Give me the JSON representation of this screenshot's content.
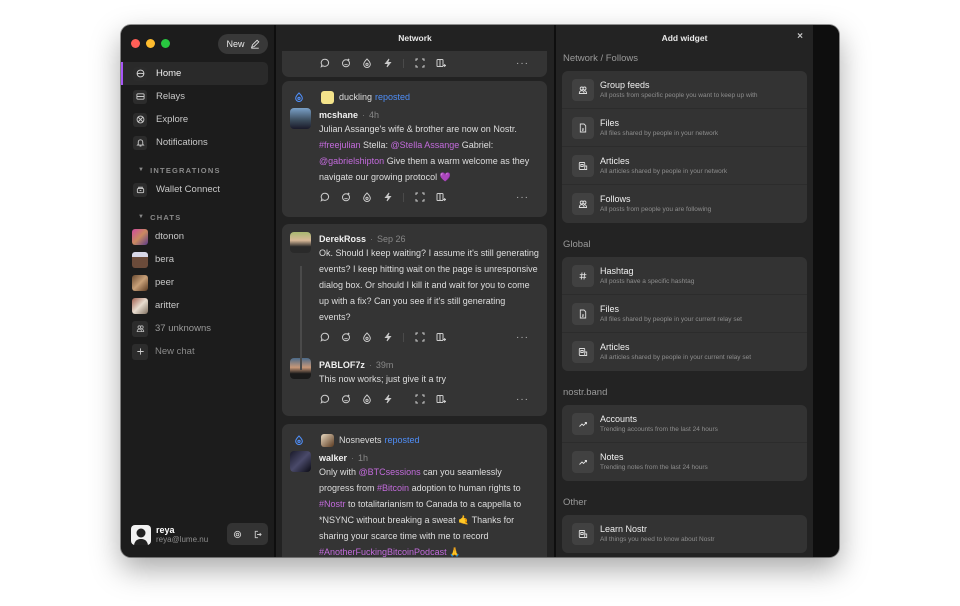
{
  "window": {
    "traffic_lights": [
      "close",
      "minimize",
      "zoom"
    ]
  },
  "sidebar": {
    "new_button": "New",
    "nav": [
      {
        "label": "Home",
        "icon": "home-icon",
        "active": true
      },
      {
        "label": "Relays",
        "icon": "relays-icon",
        "active": false
      },
      {
        "label": "Explore",
        "icon": "explore-icon",
        "active": false
      },
      {
        "label": "Notifications",
        "icon": "bell-icon",
        "active": false
      }
    ],
    "integrations_header": "INTEGRATIONS",
    "integrations": [
      {
        "label": "Wallet Connect",
        "icon": "wallet-icon"
      }
    ],
    "chats_header": "CHATS",
    "chats": [
      {
        "label": "dtonon",
        "color": "#c78a6a"
      },
      {
        "label": "bera",
        "color": "#6b4b3a"
      },
      {
        "label": "peer",
        "color": "#9a7a58"
      },
      {
        "label": "aritter",
        "color": "#b8a898"
      }
    ],
    "unknowns": "37 unknowns",
    "new_chat": "New chat",
    "user": {
      "name": "reya",
      "email": "reya@lume.nu"
    }
  },
  "network": {
    "title": "Network",
    "posts": [
      {
        "reposted_by": "duckling",
        "repost_label": "reposted",
        "author": "mcshane",
        "time": "4h",
        "segments": [
          {
            "t": "Julian Assange's wife & brother are now on Nostr. "
          },
          {
            "t": "#freejulian",
            "hl": true
          },
          {
            "t": " Stella: "
          },
          {
            "t": "@Stella Assange",
            "hl": true
          },
          {
            "t": " Gabriel: "
          },
          {
            "t": "@gabrielshipton",
            "hl": true
          },
          {
            "t": " Give them a warm welcome as they navigate our growing protocol 💜"
          }
        ]
      },
      {
        "author": "DerekRoss",
        "time": "Sep 26",
        "text": "Ok. Should I keep waiting? I assume it's still generating events? I keep hitting wait on the page is unresponsive dialog box. Or should I kill it and wait for you to come up with a fix? Can you see if it's still generating events?",
        "reply": {
          "author": "PABLOF7z",
          "time": "39m",
          "text": "This now works; just give it a try"
        }
      },
      {
        "reposted_by": "Nosnevets",
        "repost_label": "reposted",
        "author": "walker",
        "time": "1h",
        "segments": [
          {
            "t": "Only with "
          },
          {
            "t": "@BTCsessions",
            "hl": true
          },
          {
            "t": " can you seamlessly progress from "
          },
          {
            "t": "#Bitcoin",
            "hl": true
          },
          {
            "t": " adoption to human rights to "
          },
          {
            "t": "#Nostr",
            "hl": true
          },
          {
            "t": " to totalitarianism to Canada to a cappella to *NSYNC without breaking a sweat 🤙 Thanks for sharing your scarce time with me to record "
          },
          {
            "t": "#AnotherFuckingBitcoinPodcast",
            "hl": true
          },
          {
            "t": " 🙏"
          }
        ]
      }
    ],
    "more_label": "···"
  },
  "widgets": {
    "title": "Add widget",
    "close": "×",
    "sections": [
      {
        "title": "Network / Follows",
        "items": [
          {
            "title": "Group feeds",
            "desc": "All posts from specific people you want to keep up with",
            "icon": "group-icon"
          },
          {
            "title": "Files",
            "desc": "All files shared by people in your network",
            "icon": "file-icon"
          },
          {
            "title": "Articles",
            "desc": "All articles shared by people in your network",
            "icon": "article-icon"
          },
          {
            "title": "Follows",
            "desc": "All posts from people you are following",
            "icon": "group-icon"
          }
        ]
      },
      {
        "title": "Global",
        "items": [
          {
            "title": "Hashtag",
            "desc": "All posts have a specific hashtag",
            "icon": "hashtag-icon"
          },
          {
            "title": "Files",
            "desc": "All files shared by people in your current relay set",
            "icon": "file-icon"
          },
          {
            "title": "Articles",
            "desc": "All articles shared by people in your current relay set",
            "icon": "article-icon"
          }
        ]
      },
      {
        "title": "nostr.band",
        "items": [
          {
            "title": "Accounts",
            "desc": "Trending accounts from the last 24 hours",
            "icon": "trending-icon"
          },
          {
            "title": "Notes",
            "desc": "Trending notes from the last 24 hours",
            "icon": "trending-icon"
          }
        ]
      },
      {
        "title": "Other",
        "items": [
          {
            "title": "Learn Nostr",
            "desc": "All things you need to know about Nostr",
            "icon": "article-icon"
          }
        ]
      }
    ]
  },
  "colors": {
    "accent": "#a855f7",
    "repost": "#4f8ef7",
    "highlight": "#c36bdc"
  }
}
